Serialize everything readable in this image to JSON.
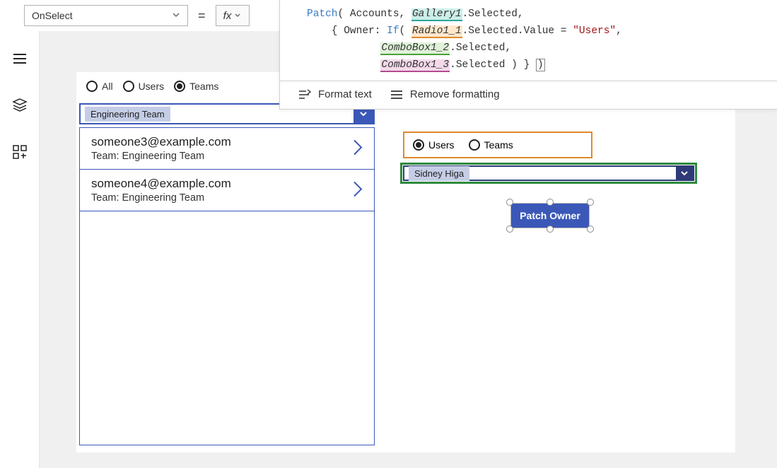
{
  "property_selector": {
    "value": "OnSelect",
    "equals": "=",
    "fx": "fx"
  },
  "formula": {
    "tokens": {
      "patch": "Patch",
      "accounts": "Accounts",
      "gallery": "Gallery1",
      "selected": ".Selected",
      "owner": "Owner:",
      "if": "If",
      "radio": "Radio1_1",
      "sel2": ".Selected.Value",
      "eq": " = ",
      "users_str": "\"Users\"",
      "combo2": "ComboBox1_2",
      "combo3": "ComboBox1_3",
      "sel3": ".Selected",
      "close": ") }",
      "paren": ")"
    },
    "toolbar": {
      "format": "Format text",
      "remove": "Remove formatting"
    }
  },
  "left_radio": {
    "all": "All",
    "users": "Users",
    "teams": "Teams",
    "selected": "Teams"
  },
  "left_combo": {
    "chip": "Engineering Team"
  },
  "gallery": {
    "items": [
      {
        "email": "someone3@example.com",
        "team": "Team: Engineering Team"
      },
      {
        "email": "someone4@example.com",
        "team": "Team: Engineering Team"
      }
    ]
  },
  "right_radio": {
    "users": "Users",
    "teams": "Teams",
    "selected": "Users"
  },
  "right_combo": {
    "chip": "Sidney Higa"
  },
  "patch_button": {
    "label": "Patch Owner"
  }
}
